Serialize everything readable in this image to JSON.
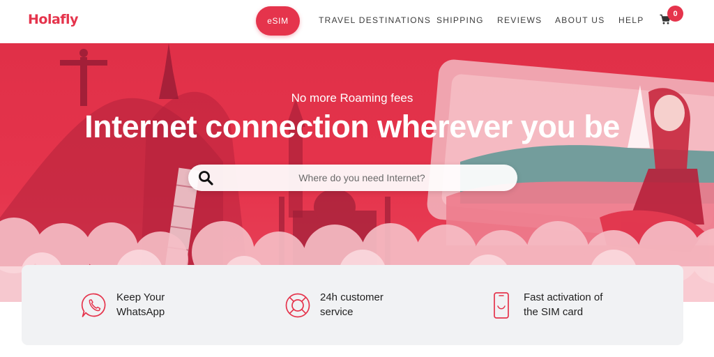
{
  "header": {
    "logo": "Holafly",
    "nav": {
      "esim": "eSIM",
      "travel_destinations": "TRAVEL DESTINATIONS",
      "shipping": "SHIPPING",
      "reviews": "REVIEWS",
      "about_us": "ABOUT US",
      "help": "HELP"
    },
    "cart_icon": "shopping-cart-icon",
    "cart_count": "0"
  },
  "hero": {
    "subtitle": "No more Roaming fees",
    "title": "Internet connection wherever you be",
    "search": {
      "placeholder": "Where do you need Internet?",
      "value": "",
      "icon": "search-icon"
    }
  },
  "features": [
    {
      "icon": "whatsapp-icon",
      "line1": "Keep Your",
      "line2": "WhatsApp"
    },
    {
      "icon": "lifebuoy-icon",
      "line1": "24h customer",
      "line2": "service"
    },
    {
      "icon": "phone-sim-icon",
      "line1": "Fast activation of",
      "line2": "the SIM card"
    }
  ],
  "colors": {
    "brand": "#e5344c",
    "hero_bg": "#e5344c",
    "card_bg": "#f1f2f4",
    "nav_text": "#3b3b3b"
  }
}
